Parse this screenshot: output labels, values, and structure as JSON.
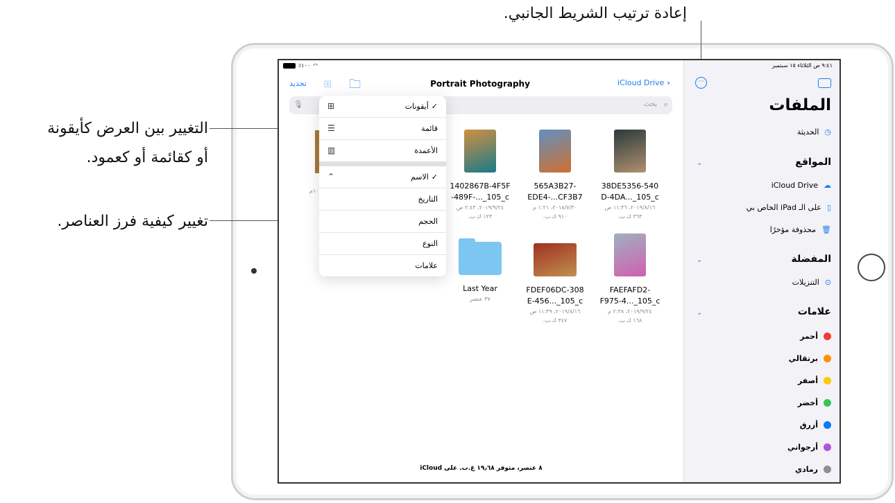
{
  "callouts": {
    "sidebar": "إعادة ترتيب الشريط الجانبي.",
    "view_1": "التغيير بين العرض كأيقونة",
    "view_2": "أو كقائمة أو كعمود.",
    "sort": "تغيير كيفية فرز العناصر."
  },
  "status": {
    "battery": "٪١٠٠",
    "time_date": "٩:٤١ ص   الثلاثاء ١٥ سبتمبر"
  },
  "toolbar": {
    "select": "تحديد",
    "title": "Portrait Photography",
    "back": "iCloud Drive"
  },
  "search": {
    "placeholder": "بحث"
  },
  "menu": {
    "view": [
      {
        "label": "أيقونات",
        "checked": true,
        "icon": "grid-icon"
      },
      {
        "label": "قائمة",
        "icon": "list-icon"
      },
      {
        "label": "الأعمدة",
        "icon": "columns-icon"
      }
    ],
    "sort": [
      {
        "label": "الاسم",
        "checked": true
      },
      {
        "label": "التاريخ"
      },
      {
        "label": "الحجم"
      },
      {
        "label": "النوع"
      },
      {
        "label": "علامات"
      }
    ]
  },
  "partial_meta": "١٠م",
  "files": [
    {
      "name1": "38DE5356-540",
      "name2": "D-4DA..._105_c",
      "date": "٢٠١٩/٨/١٦، ١١:٣٦ ص",
      "size": "٣٦٣ ك.ب."
    },
    {
      "name1": "565A3B27-",
      "name2": "EDE4-...CF3B7",
      "date": "٢٠١٨/٧/٣٠، ١:٢١ م",
      "size": "٩١٠ ك.ب."
    },
    {
      "name1": "1402867B-4F5F",
      "name2": "-489F-..._105_c",
      "date": "٢٠١٩/٩/٢٤، ٢:٤٣ ص",
      "size": "١٢٣ ك.ب."
    },
    {
      "name1": "FAEFAFD2-",
      "name2": "F975-4..._105_c",
      "date": "٢٠١٩/٩/٢٤، ٢:٣٨ م",
      "size": "١٦٨ ك.ب."
    },
    {
      "name1": "FDEF06DC-308",
      "name2": "E-456..._105_c",
      "date": "٢٠١٩/٨/١٦، ١١:٣٩ ص",
      "size": "٣٤٧ ك.ب."
    },
    {
      "name1": "Last Year",
      "name2": "",
      "date": "٣٧ عنصر",
      "size": "",
      "folder": true
    }
  ],
  "footer": "٨ عنصر، متوفر ١٩٫٦٨ غ.ب. على iCloud",
  "sidebar": {
    "title": "الملفات",
    "recents": "الحديثة",
    "locations": "المواقع",
    "loc_items": [
      "iCloud Drive",
      "على الـ iPad الخاص بي",
      "محذوفة مؤخرًا"
    ],
    "favorites": "المفضلة",
    "downloads": "التنزيلات",
    "tags": "علامات",
    "tag_items": [
      {
        "label": "أحمر",
        "color": "#f23b30"
      },
      {
        "label": "برتقالي",
        "color": "#fb9208"
      },
      {
        "label": "أصفر",
        "color": "#fdcb0a"
      },
      {
        "label": "أخضر",
        "color": "#32c659"
      },
      {
        "label": "أزرق",
        "color": "#0a7af8"
      },
      {
        "label": "أرجواني",
        "color": "#b054dc"
      },
      {
        "label": "رمادي",
        "color": "#8e8e93"
      }
    ]
  },
  "accent": "#1a7cf5"
}
